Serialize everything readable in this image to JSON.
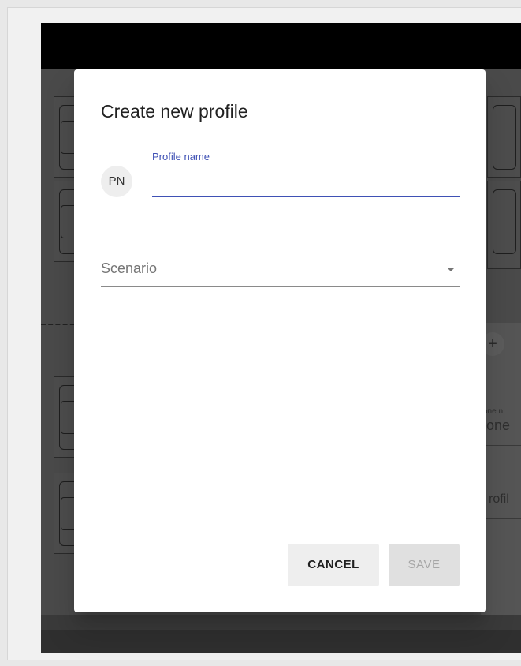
{
  "dialog": {
    "title": "Create new profile",
    "avatar_initials": "PN",
    "profile_name_label": "Profile name",
    "profile_name_value": "",
    "scenario_placeholder": "Scenario",
    "cancel_label": "CANCEL",
    "save_label": "SAVE"
  },
  "background": {
    "plus_symbol": "+",
    "zone_label_small": "one n",
    "zone_label_large": "one",
    "profile_label": "rofil"
  }
}
